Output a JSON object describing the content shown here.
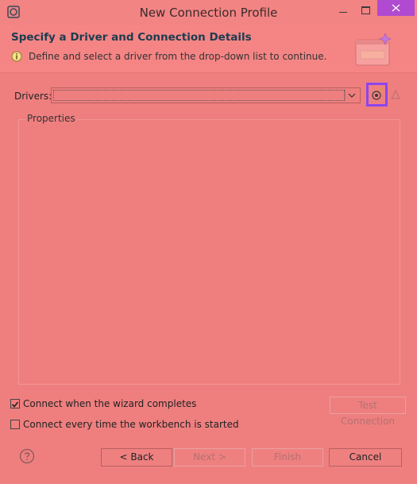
{
  "window": {
    "title": "New Connection Profile"
  },
  "header": {
    "title": "Specify a Driver and Connection Details",
    "message": "Define and select a driver from the drop-down list to continue."
  },
  "drivers": {
    "label": "Drivers:",
    "selected_value": ""
  },
  "properties": {
    "group_label": "Properties"
  },
  "options": {
    "connect_on_complete": {
      "label": "Connect when the wizard completes",
      "checked": true
    },
    "connect_on_startup": {
      "label": "Connect every time the workbench is started",
      "checked": false
    },
    "test_connection_label": "Test Connection"
  },
  "footer": {
    "back_label": "< Back",
    "next_label": "Next >",
    "finish_label": "Finish",
    "cancel_label": "Cancel"
  },
  "colors": {
    "background": "#ef7f7f",
    "highlight_border": "#8b45f0",
    "close_button": "#b04ad0",
    "header_title": "#1b3d4f"
  },
  "icons": [
    "app-icon",
    "minimize-icon",
    "maximize-icon",
    "close-icon",
    "info-icon",
    "wizard-banner-icon",
    "new-driver-icon",
    "edit-driver-icon",
    "help-icon",
    "checkmark-icon",
    "dropdown-arrow-icon"
  ]
}
